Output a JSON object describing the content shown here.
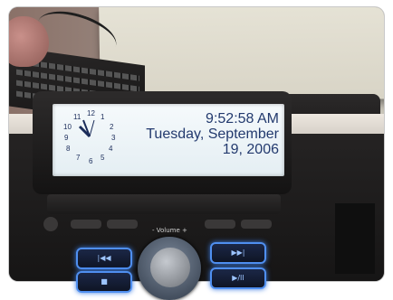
{
  "display": {
    "time": "9:52:58 AM",
    "date_line1": "Tuesday, September",
    "date_line2": "19, 2006"
  },
  "analog_clock": {
    "numerals": [
      "12",
      "1",
      "2",
      "3",
      "4",
      "5",
      "6",
      "7",
      "8",
      "9",
      "10",
      "11"
    ]
  },
  "phone": {
    "volume_label": "- Volume +",
    "buttons": {
      "prev": "|◀◀",
      "next": "▶▶|",
      "stop": "■",
      "play_pause": "▶/II"
    }
  },
  "colors": {
    "lcd_text": "#233a6e",
    "button_glow": "#4f8ff0"
  }
}
